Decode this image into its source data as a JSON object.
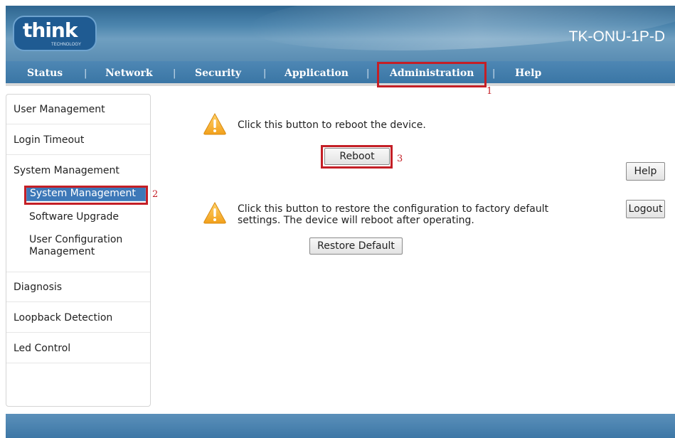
{
  "header": {
    "logo_text": "think",
    "logo_subtext": "TECHNOLOGY",
    "model": "TK-ONU-1P-D"
  },
  "nav": {
    "items": [
      "Status",
      "Network",
      "Security",
      "Application",
      "Administration",
      "Help"
    ],
    "separator": "|",
    "active": "Administration"
  },
  "sidebar": {
    "items": [
      "User Management",
      "Login Timeout",
      "System Management",
      "Diagnosis",
      "Loopback Detection",
      "Led Control"
    ],
    "subitems": [
      "System Management",
      "Software Upgrade",
      "User Configuration Management"
    ],
    "selected_sub": "System Management"
  },
  "main": {
    "reboot_message": "Click this button to reboot the device.",
    "reboot_label": "Reboot",
    "restore_message": "Click this button to restore the configuration to factory default settings. The device will reboot after operating.",
    "restore_label": "Restore Default",
    "help_label": "Help",
    "logout_label": "Logout"
  },
  "annotations": {
    "step1": "1",
    "step2": "2",
    "step3": "3",
    "color": "#c41f26"
  },
  "colors": {
    "header_blue": "#3a76a5",
    "selected_bg": "#3d78b8"
  }
}
